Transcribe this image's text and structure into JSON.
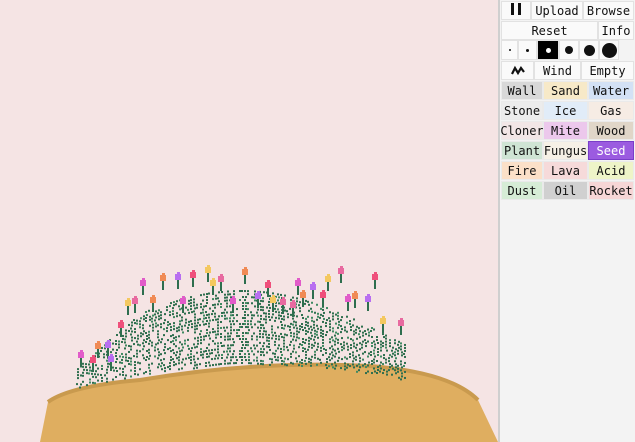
{
  "controls": {
    "upload": "Upload",
    "browse": "Browse",
    "reset": "Reset",
    "info": "Info",
    "wind": "Wind",
    "empty": "Empty"
  },
  "brush_sizes": [
    1,
    2,
    3,
    4,
    5,
    6
  ],
  "selected_brush": 3,
  "elements": [
    [
      {
        "label": "Wall",
        "color": "#d8d8d8"
      },
      {
        "label": "Sand",
        "color": "#f7e9c8"
      },
      {
        "label": "Water",
        "color": "#d3e1f5"
      }
    ],
    [
      {
        "label": "Stone",
        "color": "#ececec"
      },
      {
        "label": "Ice",
        "color": "#e1ecf8"
      },
      {
        "label": "Gas",
        "color": "#f6ece4"
      }
    ],
    [
      {
        "label": "Cloner",
        "color": "#f2e6e6"
      },
      {
        "label": "Mite",
        "color": "#ecc8ec"
      },
      {
        "label": "Wood",
        "color": "#e0d6c8"
      }
    ],
    [
      {
        "label": "Plant",
        "color": "#cfe4d4"
      },
      {
        "label": "Fungus",
        "color": "#f6f0e6"
      },
      {
        "label": "Seed",
        "color": "#9b5be0",
        "selected": true
      }
    ],
    [
      {
        "label": "Fire",
        "color": "#fbe0c8"
      },
      {
        "label": "Lava",
        "color": "#f6dada"
      },
      {
        "label": "Acid",
        "color": "#eef4c8"
      }
    ],
    [
      {
        "label": "Dust",
        "color": "#d6ecd6"
      },
      {
        "label": "Oil",
        "color": "#d0d0d0"
      },
      {
        "label": "Rocket",
        "color": "#f6d6d6"
      }
    ]
  ],
  "colors": {
    "background": "#f5e4e4",
    "sand": "#dfae60",
    "plant": "#2e6e4e",
    "flowers": [
      "#e15bc9",
      "#f08a55",
      "#b86ef0",
      "#ef4f7b",
      "#f4c860",
      "#e86aa0"
    ]
  }
}
